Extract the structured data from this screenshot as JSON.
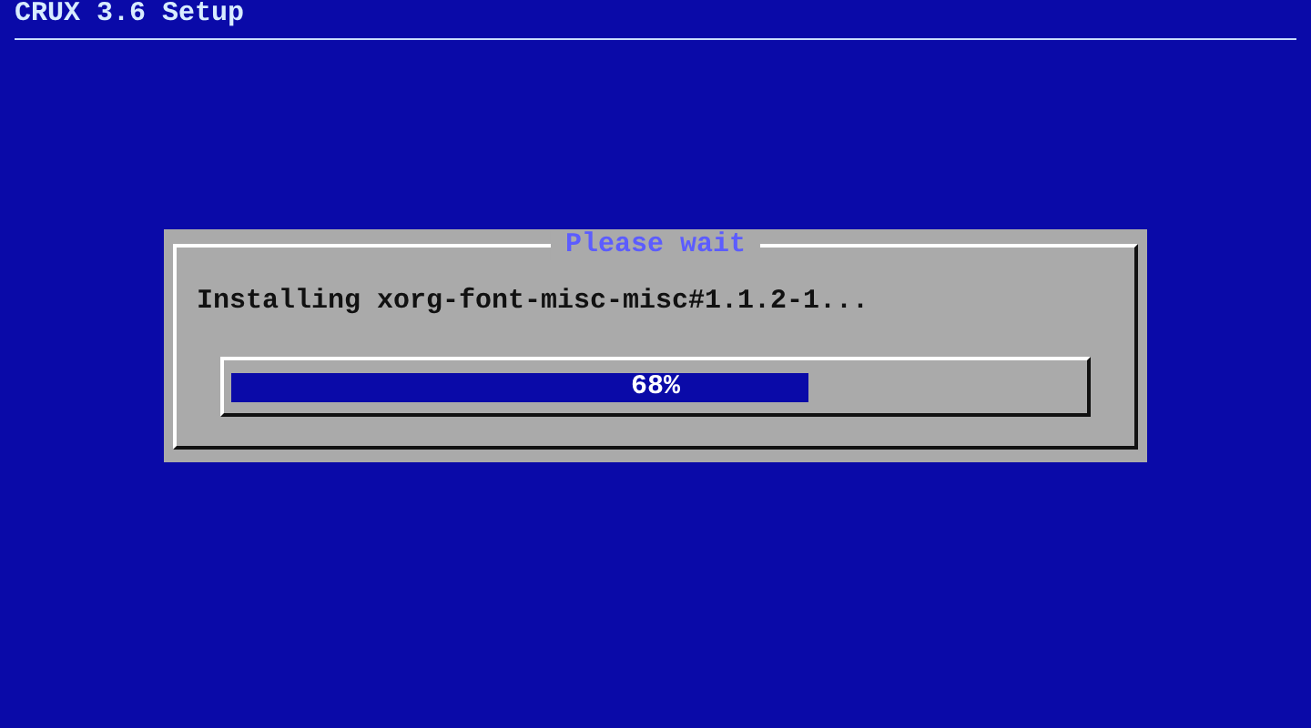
{
  "window": {
    "title": "CRUX 3.6 Setup"
  },
  "dialog": {
    "title": "Please wait",
    "message": "Installing xorg-font-misc-misc#1.1.2-1...",
    "progress": {
      "level": 0.68,
      "reading": "68%"
    }
  }
}
